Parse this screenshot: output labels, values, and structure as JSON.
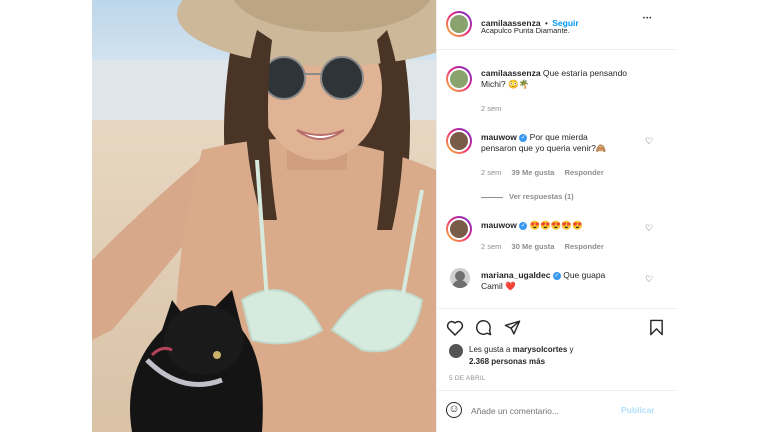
{
  "header": {
    "username": "camilaassenza",
    "dot": "•",
    "follow_label": "Seguir",
    "location": "Acapulco Punta Diamante.",
    "more_glyph": "•••"
  },
  "caption": {
    "username": "camilaassenza",
    "text": "Que estaría pensando",
    "text2": "Michi?",
    "emojis": "😳🌴",
    "time": "2 sem"
  },
  "comments": [
    {
      "username": "mauwow",
      "line1": "Por que mierda",
      "line2": "pensaron que yo queria venir?",
      "emoji": "🙈",
      "time": "2 sem",
      "likes": "39 Me gusta",
      "reply": "Responder",
      "view_replies": "Ver respuestas (1)"
    },
    {
      "username": "mauwow",
      "text": "😍😍😍😍😍",
      "time": "2 sem",
      "likes": "30 Me gusta",
      "reply": "Responder"
    },
    {
      "username": "mariana_ugaldec",
      "text": "Que guapa",
      "line2": "Camil",
      "emoji": "❤️"
    }
  ],
  "likes": {
    "prefix": "Les gusta a",
    "user": "marysolcortes",
    "conj": "y",
    "count": "2.368 personas más"
  },
  "date": "5 DE ABRIL",
  "add_comment": {
    "placeholder": "Añade un comentario...",
    "post_label": "Publicar",
    "emoji_glyph": "☺"
  },
  "colors": {
    "link_blue": "#0095f6",
    "verified_blue": "#3897f0",
    "heart_red": "#ed4956"
  }
}
